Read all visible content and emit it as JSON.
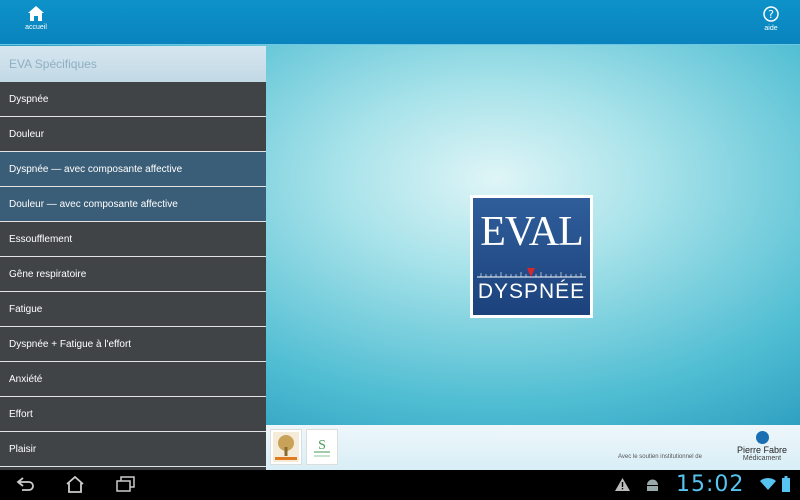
{
  "topbar": {
    "home_label": "accueil",
    "help_label": "aide"
  },
  "sidebar": {
    "header": "EVA Spécifiques",
    "items": [
      {
        "label": "Dyspnée",
        "selected": false
      },
      {
        "label": "Douleur",
        "selected": false
      },
      {
        "label": "Dyspnée — avec composante affective",
        "selected": true
      },
      {
        "label": "Douleur — avec composante affective",
        "selected": true
      },
      {
        "label": "Essoufflement",
        "selected": false
      },
      {
        "label": "Gêne respiratoire",
        "selected": false
      },
      {
        "label": "Fatigue",
        "selected": false
      },
      {
        "label": "Dyspnée + Fatigue à l'effort",
        "selected": false
      },
      {
        "label": "Anxiété",
        "selected": false
      },
      {
        "label": "Effort",
        "selected": false
      },
      {
        "label": "Plaisir",
        "selected": false
      }
    ]
  },
  "logo": {
    "top": "EVAL",
    "bottom": "DYSPNÉE"
  },
  "partners": {
    "soutien_text": "Avec le soutien institutionnel de",
    "pf_name": "Pierre Fabre",
    "pf_sub": "Médicament"
  },
  "statusbar": {
    "time": "15:02"
  },
  "colors": {
    "accent": "#0d92c9",
    "clock": "#57c3f0",
    "selected_item": "#3b5e78"
  }
}
